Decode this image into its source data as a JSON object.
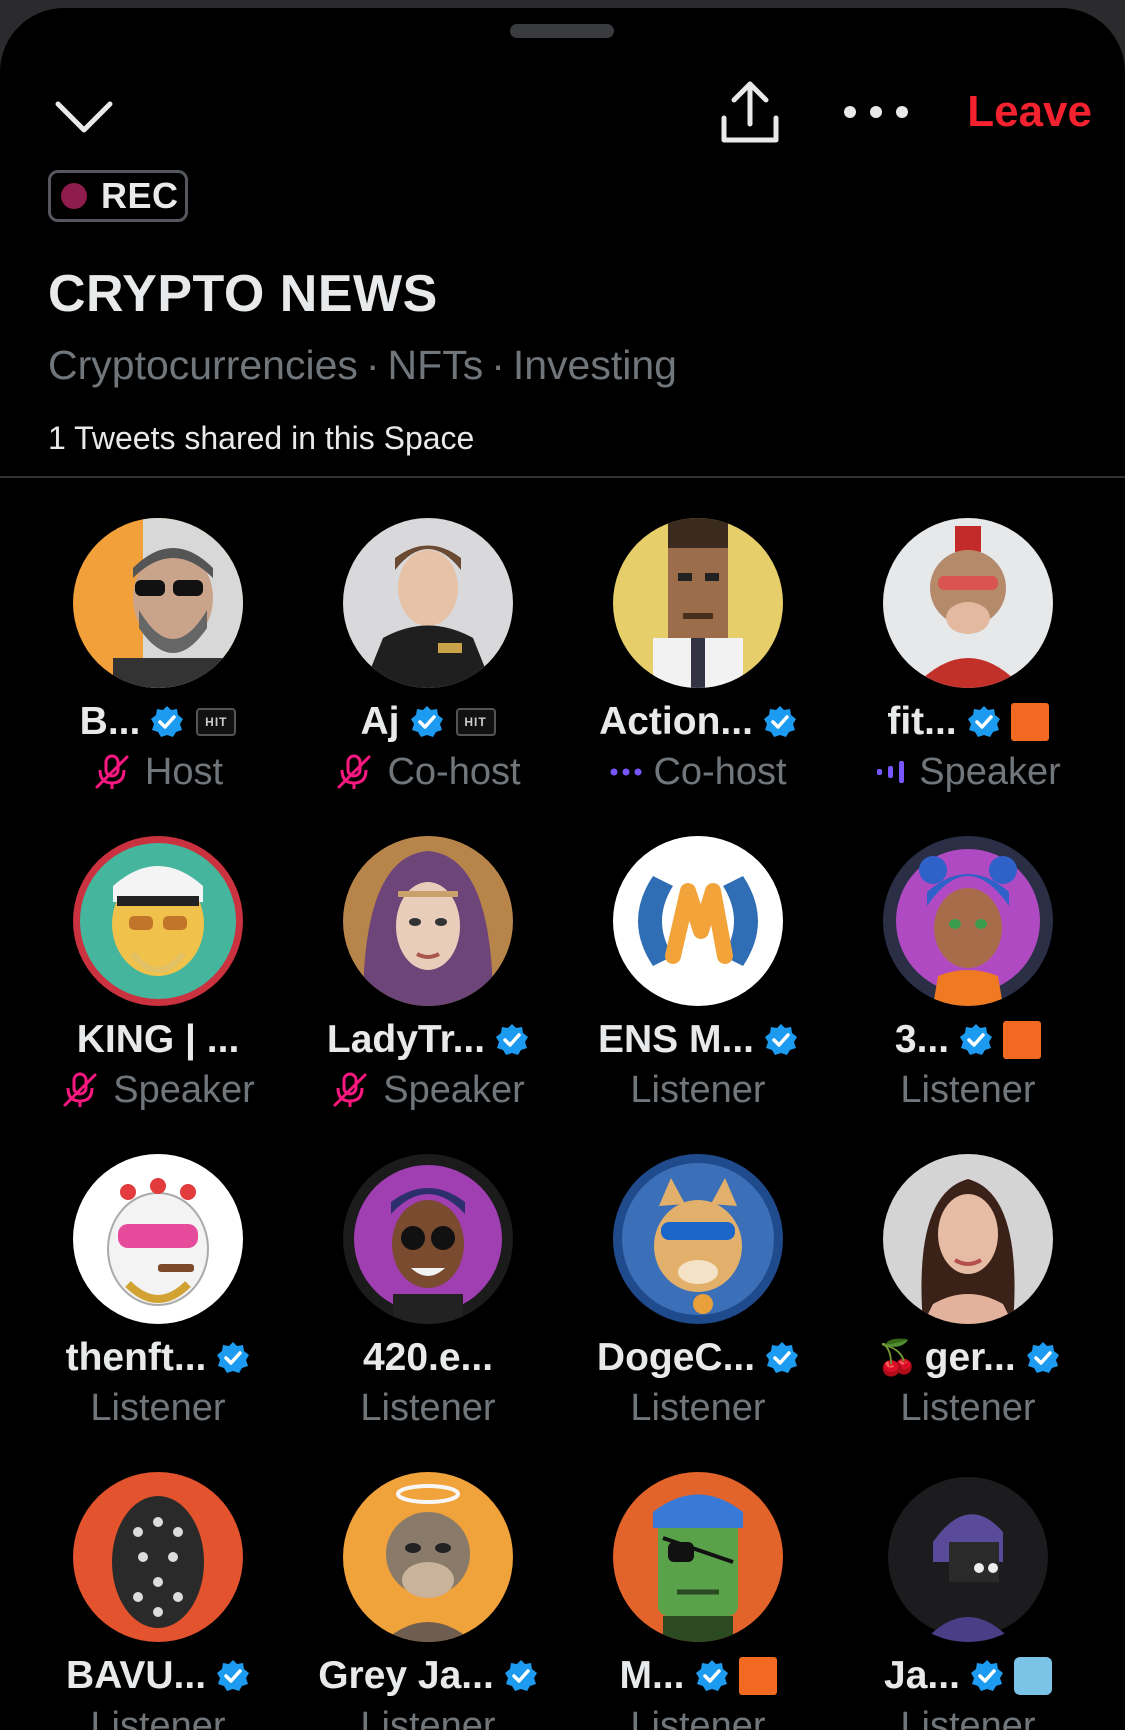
{
  "topbar": {
    "leave_label": "Leave",
    "collapse_icon": "chevron-down-icon",
    "share_icon": "share-upload-icon",
    "more_icon": "more-horizontal-icon"
  },
  "space": {
    "rec_label": "REC",
    "title": "CRYPTO NEWS",
    "topics": [
      "Cryptocurrencies",
      "NFTs",
      "Investing"
    ],
    "topic_separator": "·",
    "tweets_shared": "1 Tweets shared in this Space"
  },
  "colors": {
    "leave": "#f4212e",
    "verified": "#1d9bf0",
    "muted_mic": "#f91880",
    "speaking": "#7856ff",
    "rec_dot": "#8e1c4c"
  },
  "participants": [
    {
      "name": "B...",
      "role": "Host",
      "verified": true,
      "badge": "hit",
      "status": "muted"
    },
    {
      "name": "Aj",
      "role": "Co-host",
      "verified": true,
      "badge": "hit",
      "status": "muted"
    },
    {
      "name": "Action...",
      "role": "Co-host",
      "verified": true,
      "badge": "",
      "status": "connecting"
    },
    {
      "name": "fit...",
      "role": "Speaker",
      "verified": true,
      "badge": "orange-square",
      "status": "speaking"
    },
    {
      "name": "KING | ...",
      "role": "Speaker",
      "verified": false,
      "badge": "",
      "status": "muted"
    },
    {
      "name": "LadyTr...",
      "role": "Speaker",
      "verified": true,
      "badge": "",
      "status": "muted"
    },
    {
      "name": "ENS M...",
      "role": "Listener",
      "verified": true,
      "badge": "",
      "status": ""
    },
    {
      "name": "3...",
      "role": "Listener",
      "verified": true,
      "badge": "orange-square",
      "status": ""
    },
    {
      "name": "thenft...",
      "role": "Listener",
      "verified": true,
      "badge": "",
      "status": ""
    },
    {
      "name": "420.e...",
      "role": "Listener",
      "verified": false,
      "badge": "",
      "status": ""
    },
    {
      "name": "DogeC...",
      "role": "Listener",
      "verified": true,
      "badge": "",
      "status": ""
    },
    {
      "name": "ger...",
      "role": "Listener",
      "verified": true,
      "badge": "",
      "status": "",
      "prefix_emoji": "🍒"
    },
    {
      "name": "BAVU...",
      "role": "Listener",
      "verified": true,
      "badge": "",
      "status": ""
    },
    {
      "name": "Grey Ja...",
      "role": "Listener",
      "verified": true,
      "badge": "",
      "status": ""
    },
    {
      "name": "M...",
      "role": "Listener",
      "verified": true,
      "badge": "orange-square",
      "status": ""
    },
    {
      "name": "Ja...",
      "role": "Listener",
      "verified": true,
      "badge": "blue-square",
      "status": ""
    }
  ]
}
